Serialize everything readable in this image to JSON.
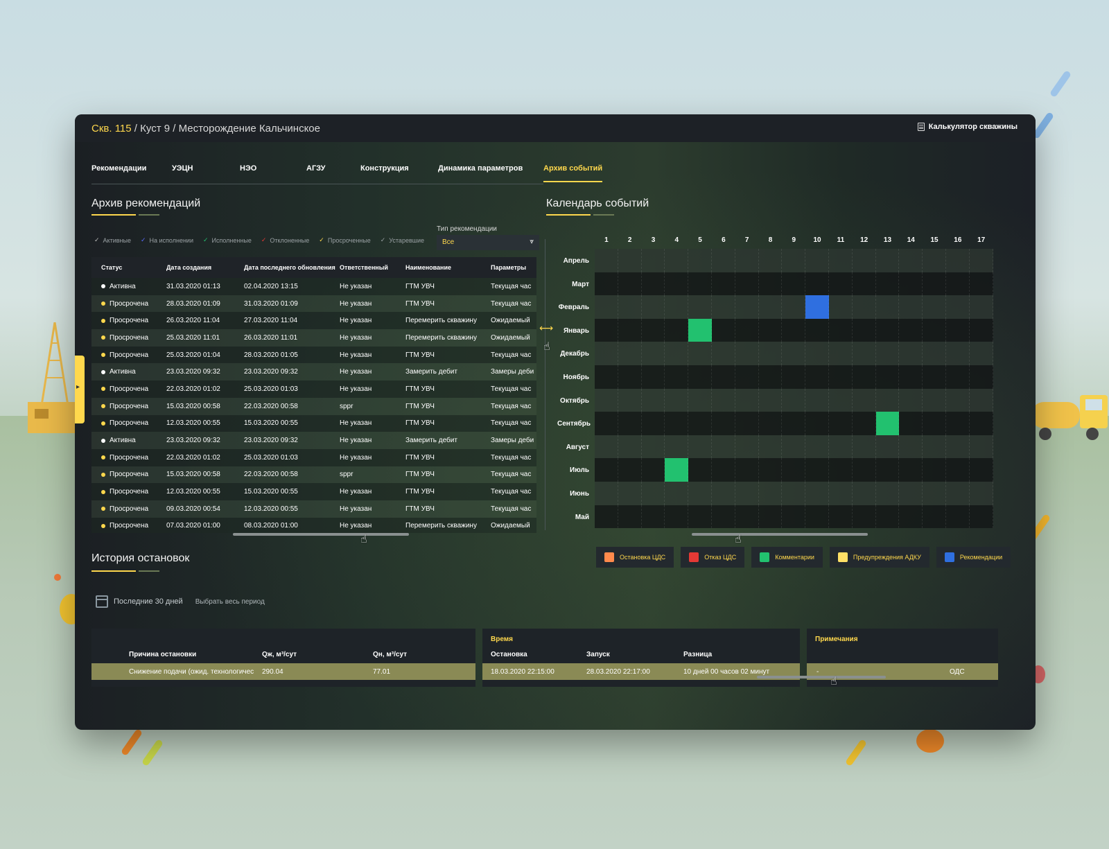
{
  "breadcrumb": {
    "well": "Скв. 115",
    "rest": " / Куст 9 / Месторождение Кальчинское"
  },
  "calc_button": "Калькулятор скважины",
  "tabs": [
    "Рекомендации",
    "УЭЦН",
    "НЭО",
    "АГЗУ",
    "Конструкция",
    "Динамика параметров",
    "Архив событий"
  ],
  "archive": {
    "title": "Архив рекомендаций",
    "filters": [
      {
        "label": "Активные",
        "color": "#bfbfbf"
      },
      {
        "label": "На исполнении",
        "color": "#5a6cff"
      },
      {
        "label": "Исполненные",
        "color": "#22c16f"
      },
      {
        "label": "Отклоненные",
        "color": "#e53935"
      },
      {
        "label": "Просроченные",
        "color": "#ffd84d"
      },
      {
        "label": "Устаревшие",
        "color": "#9aa1a4"
      }
    ],
    "type_label": "Тип рекомендации",
    "type_value": "Все",
    "columns": [
      "Статус",
      "Дата создания",
      "Дата последнего обновления",
      "Ответственный",
      "Наименование",
      "Параметры"
    ],
    "rows": [
      [
        "Активна",
        "31.03.2020 01:13",
        "02.04.2020 13:15",
        "Не указан",
        "ГТМ УВЧ",
        "Текущая час"
      ],
      [
        "Просрочена",
        "28.03.2020 01:09",
        "31.03.2020 01:09",
        "Не указан",
        "ГТМ УВЧ",
        "Текущая час"
      ],
      [
        "Просрочена",
        "26.03.2020 11:04",
        "27.03.2020 11:04",
        "Не указан",
        "Перемерить скважину",
        "Ожидаемый"
      ],
      [
        "Просрочена",
        "25.03.2020 11:01",
        "26.03.2020 11:01",
        "Не указан",
        "Перемерить скважину",
        "Ожидаемый"
      ],
      [
        "Просрочена",
        "25.03.2020 01:04",
        "28.03.2020 01:05",
        "Не указан",
        "ГТМ УВЧ",
        "Текущая час"
      ],
      [
        "Активна",
        "23.03.2020 09:32",
        "23.03.2020 09:32",
        "Не указан",
        "Замерить дебит",
        "Замеры деби"
      ],
      [
        "Просрочена",
        "22.03.2020 01:02",
        "25.03.2020 01:03",
        "Не указан",
        "ГТМ УВЧ",
        "Текущая час"
      ],
      [
        "Просрочена",
        "15.03.2020 00:58",
        "22.03.2020 00:58",
        "sppr",
        "ГТМ УВЧ",
        "Текущая час"
      ],
      [
        "Просрочена",
        "12.03.2020 00:55",
        "15.03.2020 00:55",
        "Не указан",
        "ГТМ УВЧ",
        "Текущая час"
      ],
      [
        "Активна",
        "23.03.2020 09:32",
        "23.03.2020 09:32",
        "Не указан",
        "Замерить дебит",
        "Замеры деби"
      ],
      [
        "Просрочена",
        "22.03.2020 01:02",
        "25.03.2020 01:03",
        "Не указан",
        "ГТМ УВЧ",
        "Текущая час"
      ],
      [
        "Просрочена",
        "15.03.2020 00:58",
        "22.03.2020 00:58",
        "sppr",
        "ГТМ УВЧ",
        "Текущая час"
      ],
      [
        "Просрочена",
        "12.03.2020 00:55",
        "15.03.2020 00:55",
        "Не указан",
        "ГТМ УВЧ",
        "Текущая час"
      ],
      [
        "Просрочена",
        "09.03.2020 00:54",
        "12.03.2020 00:55",
        "Не указан",
        "ГТМ УВЧ",
        "Текущая час"
      ],
      [
        "Просрочена",
        "07.03.2020 01:00",
        "08.03.2020 01:00",
        "Не указан",
        "Перемерить скважину",
        "Ожидаемый"
      ]
    ],
    "status_colors": {
      "Активна": "#ffffff",
      "Просрочена": "#ffd84d"
    }
  },
  "calendar": {
    "title": "Календарь событий",
    "days": [
      "1",
      "2",
      "3",
      "4",
      "5",
      "6",
      "7",
      "8",
      "9",
      "10",
      "11",
      "12",
      "13",
      "14",
      "15",
      "16",
      "17"
    ],
    "months": [
      "Апрель",
      "Март",
      "Февраль",
      "Январь",
      "Декабрь",
      "Ноябрь",
      "Октябрь",
      "Сентябрь",
      "Август",
      "Июль",
      "Июнь",
      "Май"
    ],
    "events": [
      {
        "month": "Февраль",
        "day": 10,
        "type": "Рекомендации"
      },
      {
        "month": "Январь",
        "day": 5,
        "type": "Комментарии"
      },
      {
        "month": "Сентябрь",
        "day": 13,
        "type": "Комментарии"
      },
      {
        "month": "Июль",
        "day": 4,
        "type": "Комментарии"
      }
    ],
    "legend": [
      {
        "label": "Остановка ЦДС",
        "color": "#ff8a4c"
      },
      {
        "label": "Отказ ЦДС",
        "color": "#e53935"
      },
      {
        "label": "Комментарии",
        "color": "#22c16f"
      },
      {
        "label": "Предупреждения АДКУ",
        "color": "#ffe066"
      },
      {
        "label": "Рекомендации",
        "color": "#2f6fe0"
      }
    ]
  },
  "history": {
    "title": "История остановок",
    "period": "Последние 30 дней",
    "select_all": "Выбрать весь период",
    "cols_left": [
      "Причина остановки",
      "Qж, м³/сут",
      "Qн, м³/сут"
    ],
    "time_group": "Время",
    "cols_time": [
      "Остановка",
      "Запуск",
      "Разница"
    ],
    "notes_group": "Примечания",
    "row": {
      "reason": "Снижение подачи (ожид. технологичес",
      "qzh": "290.04",
      "qn": "77.01",
      "stop": "18.03.2020 22:15:00",
      "start": "28.03.2020 22:17:00",
      "diff": "10 дней 00 часов 02 минут",
      "note": "-",
      "source": "ОДС"
    }
  }
}
